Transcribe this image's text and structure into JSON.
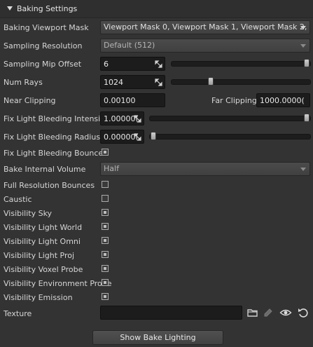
{
  "section": {
    "title": "Baking Settings"
  },
  "fields": {
    "viewport_mask": {
      "label": "Baking Viewport Mask",
      "value": "Viewport Mask 0, Viewport Mask 1, Viewport Mask 2, Vie..."
    },
    "sampling_resolution": {
      "label": "Sampling Resolution",
      "value": "Default (512)"
    },
    "sampling_mip_offset": {
      "label": "Sampling Mip Offset",
      "value": "6",
      "slider_fraction": 1.0
    },
    "num_rays": {
      "label": "Num Rays",
      "value": "1024",
      "slider_fraction": 0.27
    },
    "near_clipping": {
      "label": "Near Clipping",
      "value": "0.00100"
    },
    "far_clipping": {
      "label": "Far Clipping",
      "value": "1000.0000("
    },
    "fix_light_bleeding_intensity": {
      "label": "Fix Light Bleeding Intensity",
      "value": "1.00000(",
      "slider_fraction": 1.0
    },
    "fix_light_bleeding_radius": {
      "label": "Fix Light Bleeding Radius",
      "value": "0.00000(",
      "slider_fraction": 0.0
    },
    "fix_light_bleeding_bounce": {
      "label": "Fix Light Bleeding Bounce",
      "checked": true
    },
    "bake_internal_volume": {
      "label": "Bake Internal Volume",
      "value": "Half"
    },
    "full_resolution_bounces": {
      "label": "Full Resolution Bounces",
      "checked": false
    },
    "caustic": {
      "label": "Caustic",
      "checked": false
    },
    "visibility_sky": {
      "label": "Visibility Sky",
      "checked": true
    },
    "visibility_light_world": {
      "label": "Visibility Light World",
      "checked": true
    },
    "visibility_light_omni": {
      "label": "Visibility Light Omni",
      "checked": true
    },
    "visibility_light_proj": {
      "label": "Visibility Light Proj",
      "checked": true
    },
    "visibility_voxel_probe": {
      "label": "Visibility Voxel Probe",
      "checked": true
    },
    "visibility_environment_probe": {
      "label": "Visibility Environment Probe",
      "checked": true
    },
    "visibility_emission": {
      "label": "Visibility Emission",
      "checked": true
    },
    "texture": {
      "label": "Texture",
      "value": ""
    }
  },
  "icons": {
    "folder": "folder-icon",
    "edit": "pencil-edit-icon",
    "view": "eye-icon",
    "reset": "reset-icon"
  },
  "buttons": {
    "show_bake_lighting": "Show Bake Lighting"
  },
  "colors": {
    "background": "#333333",
    "field_dark": "#1c1c1c",
    "dropdown": "#464646",
    "text": "#d8d8d8"
  }
}
